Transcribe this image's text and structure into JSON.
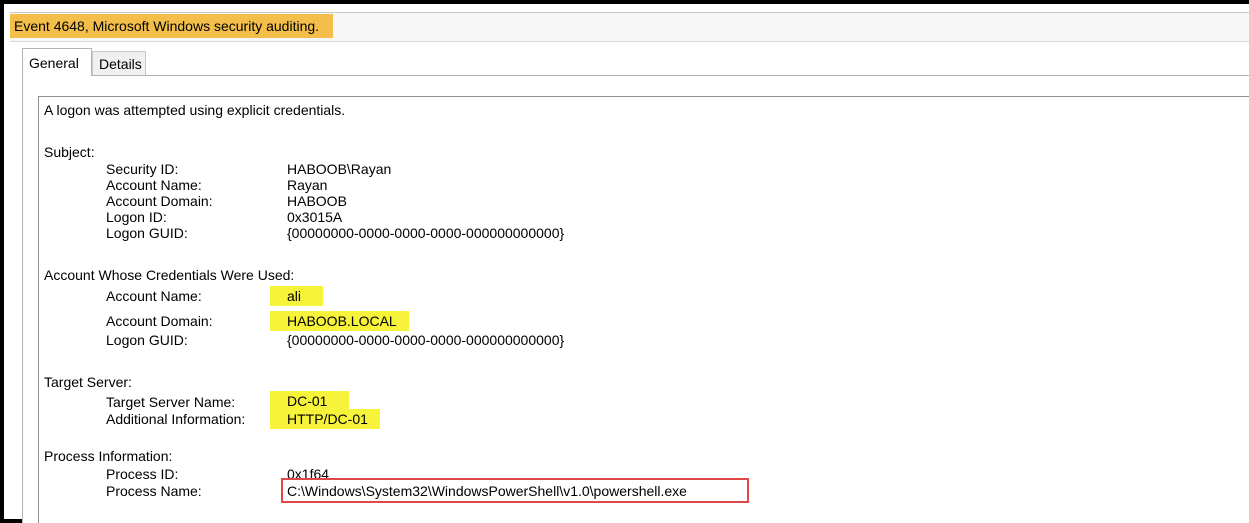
{
  "window": {
    "title": "Event 4648, Microsoft Windows security auditing."
  },
  "tabs": [
    {
      "label": "General"
    },
    {
      "label": "Details"
    }
  ],
  "event": {
    "summary": "A logon was attempted using explicit credentials.",
    "subject": {
      "heading": "Subject:",
      "fields": [
        {
          "label": "Security ID:",
          "value": "HABOOB\\Rayan"
        },
        {
          "label": "Account Name:",
          "value": "Rayan"
        },
        {
          "label": "Account Domain:",
          "value": "HABOOB"
        },
        {
          "label": "Logon ID:",
          "value": "0x3015A"
        },
        {
          "label": "Logon GUID:",
          "value": "{00000000-0000-0000-0000-000000000000}"
        }
      ]
    },
    "credentials": {
      "heading": "Account Whose Credentials Were Used:",
      "fields": [
        {
          "label": "Account Name:",
          "value": "ali"
        },
        {
          "label": "Account Domain:",
          "value": "HABOOB.LOCAL"
        },
        {
          "label": "Logon GUID:",
          "value": "{00000000-0000-0000-0000-000000000000}"
        }
      ]
    },
    "target": {
      "heading": "Target Server:",
      "fields": [
        {
          "label": "Target Server Name:",
          "value": "DC-01"
        },
        {
          "label": "Additional Information:",
          "value": "HTTP/DC-01"
        }
      ]
    },
    "process": {
      "heading": "Process Information:",
      "fields": [
        {
          "label": "Process ID:",
          "value": "0x1f64"
        },
        {
          "label": "Process Name:",
          "value": "C:\\Windows\\System32\\WindowsPowerShell\\v1.0\\powershell.exe"
        }
      ]
    }
  },
  "colors": {
    "title_highlight": "#f3bf4a",
    "value_highlight": "#f7f23a",
    "annotation_box": "#e04848"
  }
}
